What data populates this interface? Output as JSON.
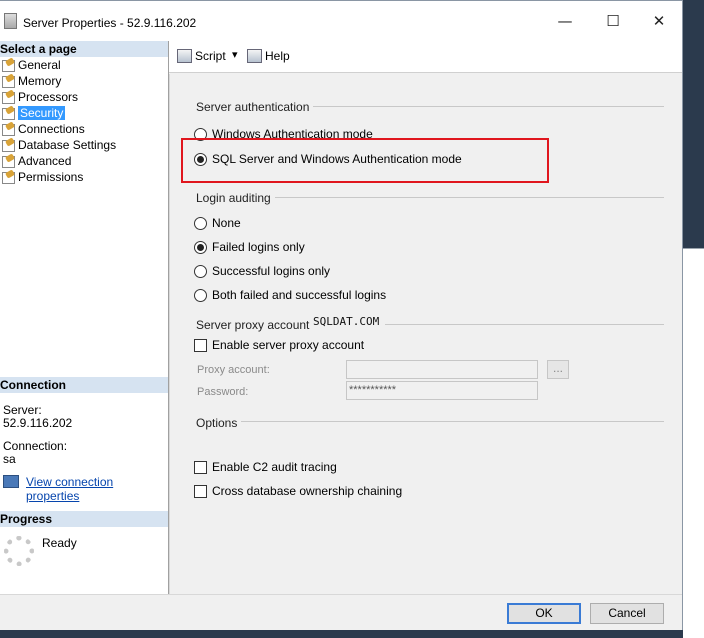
{
  "window": {
    "title": "Server Properties - 52.9.116.202",
    "minimize_glyph": "—",
    "maximize_glyph": "☐",
    "close_glyph": "✕"
  },
  "left": {
    "select_page_header": "Select a page",
    "pages": [
      {
        "label": "General",
        "selected": false
      },
      {
        "label": "Memory",
        "selected": false
      },
      {
        "label": "Processors",
        "selected": false
      },
      {
        "label": "Security",
        "selected": true
      },
      {
        "label": "Connections",
        "selected": false
      },
      {
        "label": "Database Settings",
        "selected": false
      },
      {
        "label": "Advanced",
        "selected": false
      },
      {
        "label": "Permissions",
        "selected": false
      }
    ],
    "connection_header": "Connection",
    "server_label": "Server:",
    "server_value": "52.9.116.202",
    "connection_label": "Connection:",
    "connection_value": "sa",
    "view_connection_link": "View connection properties",
    "progress_header": "Progress",
    "progress_status": "Ready"
  },
  "toolbar": {
    "script_label": "Script",
    "script_dropdown_glyph": "▾",
    "help_label": "Help"
  },
  "security": {
    "server_auth_group": "Server authentication",
    "auth_options": [
      {
        "label": "Windows Authentication mode",
        "checked": false
      },
      {
        "label": "SQL Server and Windows Authentication mode",
        "checked": true
      }
    ],
    "login_auditing_group": "Login auditing",
    "audit_options": [
      {
        "label": "None",
        "checked": false
      },
      {
        "label": "Failed logins only",
        "checked": true
      },
      {
        "label": "Successful logins only",
        "checked": false
      },
      {
        "label": "Both failed and successful logins",
        "checked": false
      }
    ],
    "proxy_group": "Server proxy account",
    "watermark": "SQLDAT.COM",
    "enable_proxy_label": "Enable server proxy account",
    "proxy_account_label": "Proxy account:",
    "proxy_account_value": "",
    "ellipsis_label": "...",
    "password_label": "Password:",
    "password_value": "***********",
    "options_group": "Options",
    "c2_audit_label": "Enable C2 audit tracing",
    "cross_db_label": "Cross database ownership chaining"
  },
  "footer": {
    "ok_label": "OK",
    "cancel_label": "Cancel"
  },
  "colors": {
    "selection": "#3399ff",
    "header_band": "#d6e3f1",
    "highlight_box": "#e0161e",
    "link": "#0645ad"
  }
}
